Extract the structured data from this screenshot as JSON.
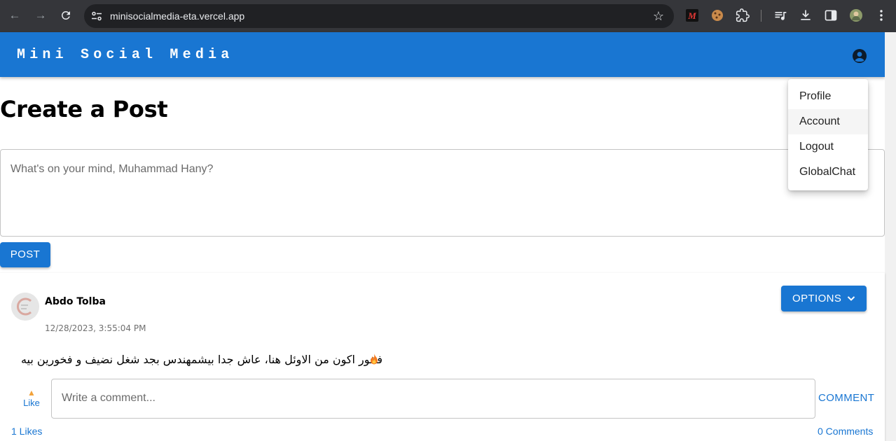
{
  "browser": {
    "url": "minisocialmedia-eta.vercel.app",
    "icons": [
      "back-icon",
      "forward-icon",
      "reload-icon",
      "site-settings-icon",
      "star-icon",
      "extensions-icon",
      "media-icon",
      "download-icon",
      "side-panel-icon",
      "profile-avatar",
      "menu-icon"
    ]
  },
  "appbar": {
    "brand": "Mini Social Media",
    "color": "#1976d2"
  },
  "page": {
    "title": "Create a Post",
    "composer_placeholder": "What's on your mind, Muhammad Hany?",
    "post_button": "POST"
  },
  "account_menu": {
    "items": [
      {
        "label": "Profile"
      },
      {
        "label": "Account"
      },
      {
        "label": "Logout"
      },
      {
        "label": "GlobalChat"
      }
    ]
  },
  "post": {
    "author": "Abdo Tolba",
    "date": "12/28/2023, 3:55:04 PM",
    "options_button": "OPTIONS",
    "content": "فخور اكون من الاوئل هنا، عاش جدا بيشمهندس بجد شغل نضيف و فخورين بيه",
    "like_label": "Like",
    "comment_placeholder": "Write a comment...",
    "comment_button": "COMMENT",
    "likes_count": "1 Likes",
    "comments_count": "0 Comments"
  }
}
